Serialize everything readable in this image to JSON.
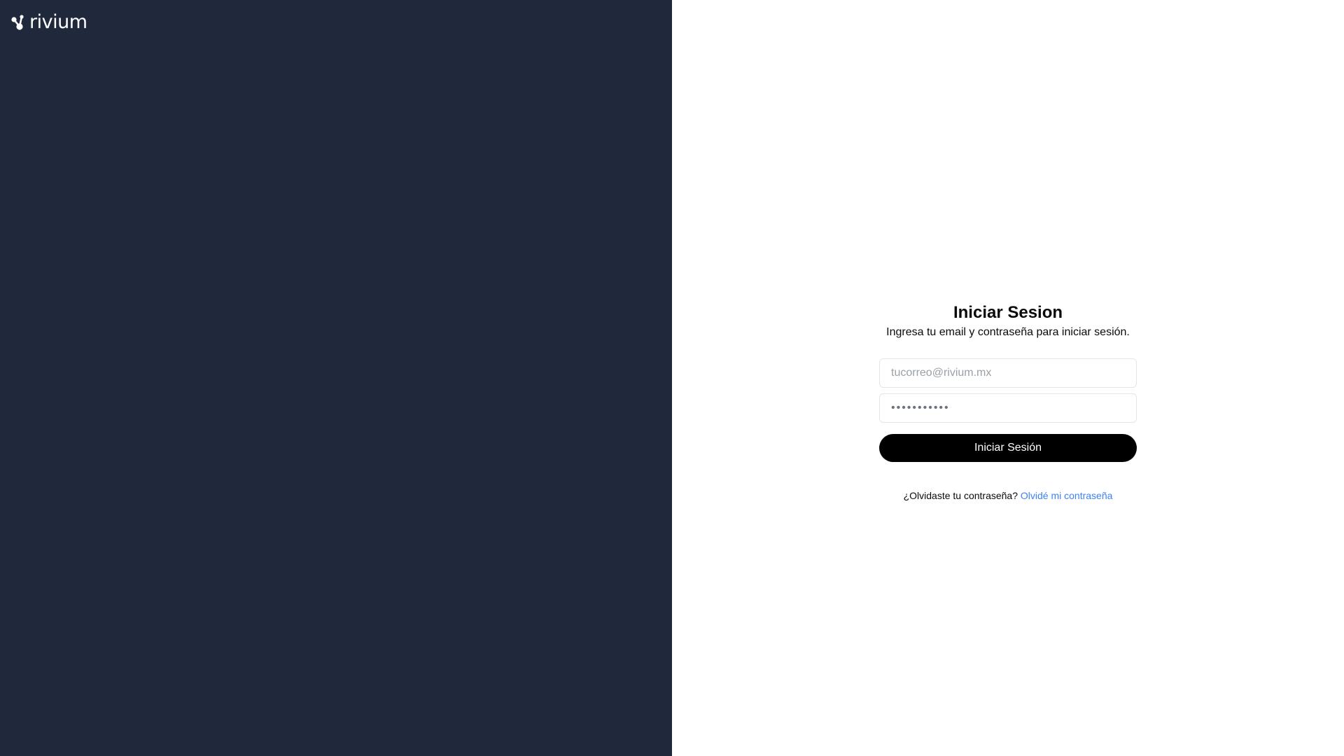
{
  "brand": {
    "name": "rivium",
    "logo_icon": "rivium-logo-mark-icon",
    "panel_color": "#1f293b"
  },
  "login": {
    "title": "Iniciar Sesion",
    "subtitle": "Ingresa tu email y contraseña para iniciar sesión.",
    "email_placeholder": "tucorreo@rivium.mx",
    "password_placeholder": "•••••••••••",
    "submit_label": "Iniciar Sesión",
    "forgot_prompt": "¿Olvidaste tu contraseña?",
    "forgot_link": "Olvidé mi contraseña",
    "link_color": "#3b82f6",
    "button_color": "#000000"
  }
}
